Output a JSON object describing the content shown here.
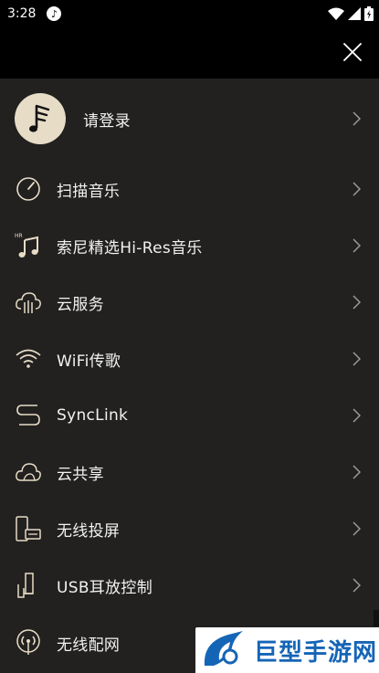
{
  "status_bar": {
    "time": "3:28"
  },
  "menu": {
    "login": {
      "label": "请登录"
    },
    "items": [
      {
        "label": "扫描音乐",
        "icon": "scan-gauge-icon"
      },
      {
        "label": "索尼精选Hi-Res音乐",
        "icon": "hires-music-icon",
        "badge": "HR"
      },
      {
        "label": "云服务",
        "icon": "cloud-service-icon"
      },
      {
        "label": "WiFi传歌",
        "icon": "wifi-icon"
      },
      {
        "label": "SyncLink",
        "icon": "synclink-icon"
      },
      {
        "label": "云共享",
        "icon": "cloud-share-icon"
      },
      {
        "label": "无线投屏",
        "icon": "screen-cast-icon"
      },
      {
        "label": "USB耳放控制",
        "icon": "usb-amp-icon"
      },
      {
        "label": "无线配网",
        "icon": "wireless-network-icon"
      }
    ]
  },
  "watermark": {
    "text": "巨型手游网"
  },
  "colors": {
    "accent": "#e7dcc6",
    "panel": "#222120",
    "brand_blue": "#1565b6"
  }
}
